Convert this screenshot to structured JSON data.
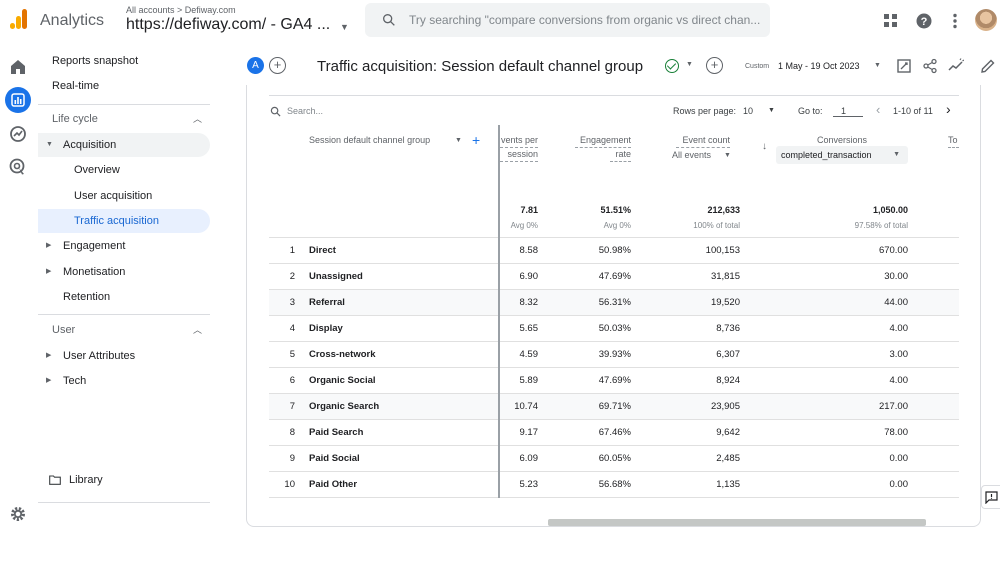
{
  "topbar": {
    "app_name": "Analytics",
    "account_crumb": "All accounts > Defiway.com",
    "property": "https://defiway.com/ - GA4 ...",
    "search_placeholder": "Try searching \"compare conversions from organic vs direct chan...",
    "icons": [
      "apps-grid-icon",
      "help-icon",
      "more-vert-icon",
      "user-avatar"
    ]
  },
  "rail": {
    "icons": [
      "home-icon",
      "reports-icon",
      "explore-icon",
      "advertising-icon",
      "settings-icon"
    ],
    "active": "reports-icon"
  },
  "nav": {
    "reports_snapshot": "Reports snapshot",
    "realtime": "Real-time",
    "lifecycle": "Life cycle",
    "acquisition": "Acquisition",
    "overview": "Overview",
    "user_acquisition": "User acquisition",
    "traffic_acquisition": "Traffic acquisition",
    "engagement": "Engagement",
    "monetisation": "Monetisation",
    "retention": "Retention",
    "user": "User",
    "user_attributes": "User Attributes",
    "tech": "Tech",
    "library": "Library"
  },
  "header": {
    "compare_chip": "A",
    "title": "Traffic acquisition: Session default channel group",
    "date_label": "Custom",
    "date_range": "1 May - 19 Oct 2023"
  },
  "toolbar": {
    "search_placeholder": "Search...",
    "rows_per_page_label": "Rows per page:",
    "rows_per_page_value": "10",
    "goto_label": "Go to:",
    "goto_value": "1",
    "pagination": "1-10 of 11"
  },
  "table": {
    "dimension_header": "Session default channel group",
    "columns": {
      "events_per_session": [
        "vents per",
        "session"
      ],
      "engagement_rate": [
        "Engagement",
        "rate"
      ],
      "event_count": "Event count",
      "event_count_filter": "All events",
      "conversions": "Conversions",
      "conversions_filter": "completed_transaction",
      "cut_col": "To"
    },
    "totals": {
      "events_per_session": "7.81",
      "events_per_session_sub": "Avg 0%",
      "engagement_rate": "51.51%",
      "engagement_rate_sub": "Avg 0%",
      "event_count": "212,633",
      "event_count_sub": "100% of total",
      "conversions": "1,050.00",
      "conversions_sub": "97.58% of total"
    },
    "rows": [
      {
        "n": "1",
        "name": "Direct",
        "eps": "8.58",
        "er": "50.98%",
        "ec": "100,153",
        "conv": "670.00"
      },
      {
        "n": "2",
        "name": "Unassigned",
        "eps": "6.90",
        "er": "47.69%",
        "ec": "31,815",
        "conv": "30.00"
      },
      {
        "n": "3",
        "name": "Referral",
        "eps": "8.32",
        "er": "56.31%",
        "ec": "19,520",
        "conv": "44.00"
      },
      {
        "n": "4",
        "name": "Display",
        "eps": "5.65",
        "er": "50.03%",
        "ec": "8,736",
        "conv": "4.00"
      },
      {
        "n": "5",
        "name": "Cross-network",
        "eps": "4.59",
        "er": "39.93%",
        "ec": "6,307",
        "conv": "3.00"
      },
      {
        "n": "6",
        "name": "Organic Social",
        "eps": "5.89",
        "er": "47.69%",
        "ec": "8,924",
        "conv": "4.00"
      },
      {
        "n": "7",
        "name": "Organic Search",
        "eps": "10.74",
        "er": "69.71%",
        "ec": "23,905",
        "conv": "217.00"
      },
      {
        "n": "8",
        "name": "Paid Search",
        "eps": "9.17",
        "er": "67.46%",
        "ec": "9,642",
        "conv": "78.00"
      },
      {
        "n": "9",
        "name": "Paid Social",
        "eps": "6.09",
        "er": "60.05%",
        "ec": "2,485",
        "conv": "0.00"
      },
      {
        "n": "10",
        "name": "Paid Other",
        "eps": "5.23",
        "er": "56.68%",
        "ec": "1,135",
        "conv": "0.00"
      }
    ]
  },
  "colors": {
    "accent": "#1a73e8",
    "selected_nav_bg": "#e8f0fe",
    "brand_orange": "#e37400",
    "brand_yellow": "#f9ab00"
  }
}
